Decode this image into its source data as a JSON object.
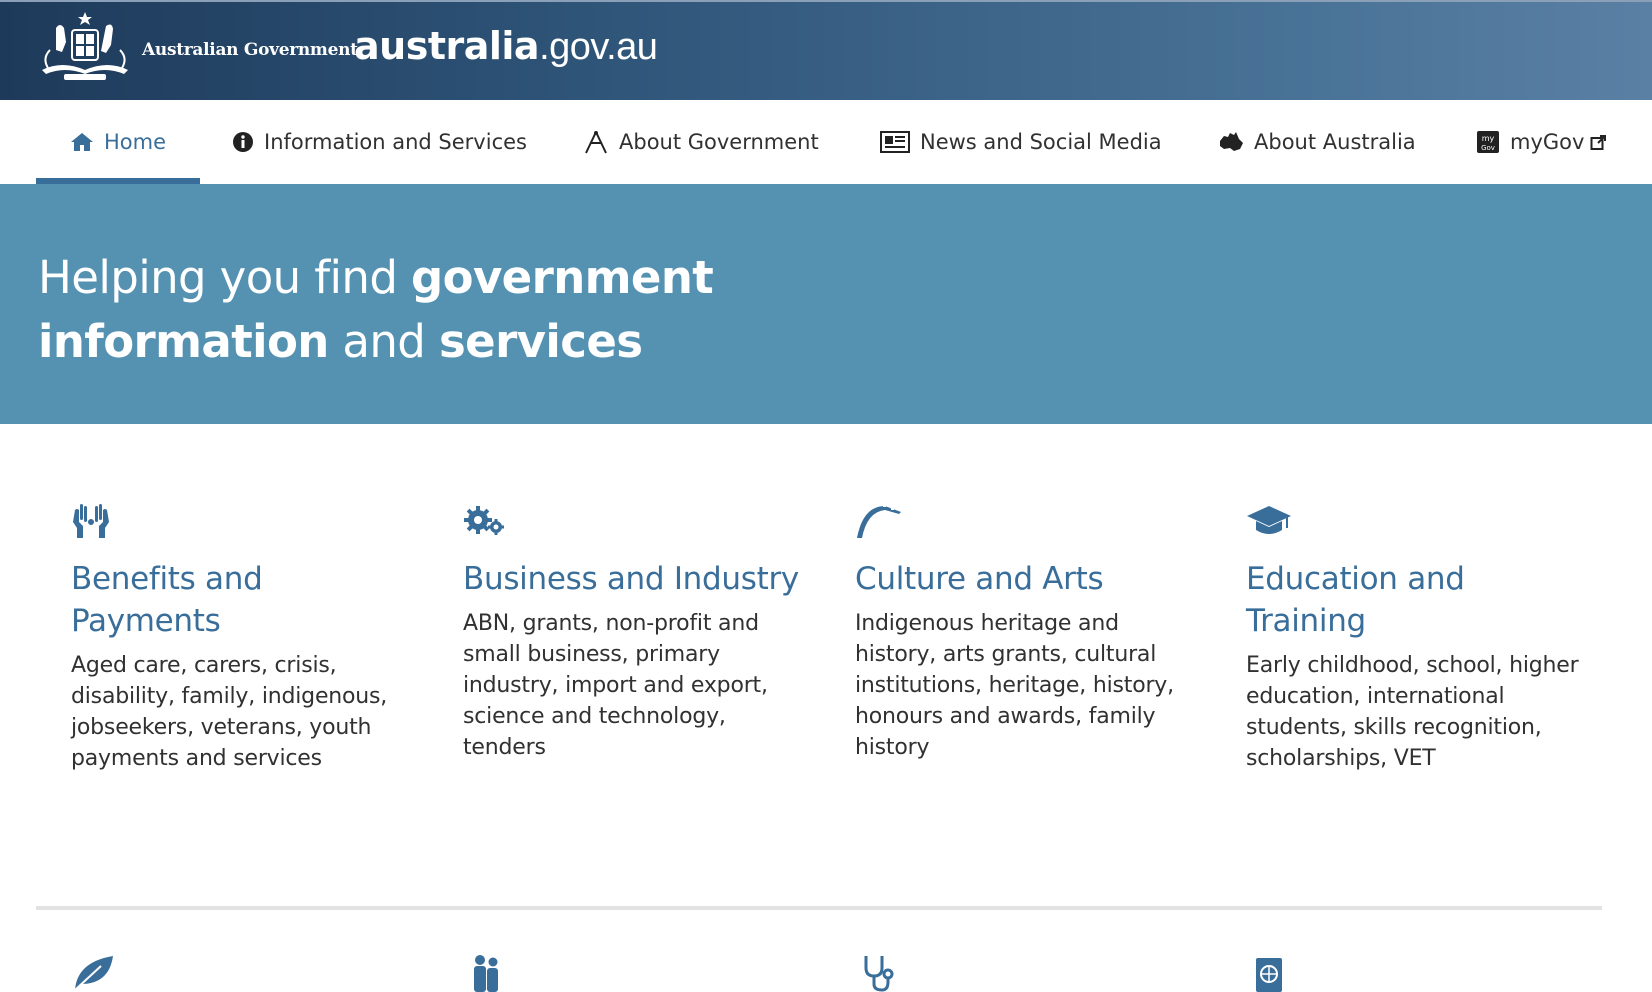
{
  "header": {
    "gov_name": "Australian Government",
    "site_brand": "australia",
    "site_domain": ".gov.au"
  },
  "nav": {
    "items": [
      {
        "label": "Home",
        "icon": "home-icon",
        "active": true
      },
      {
        "label": "Information and Services",
        "icon": "info-icon"
      },
      {
        "label": "About Government",
        "icon": "compass-icon"
      },
      {
        "label": "News and Social Media",
        "icon": "newspaper-icon"
      },
      {
        "label": "About Australia",
        "icon": "australia-map-icon"
      },
      {
        "label": "myGov",
        "icon": "mygov-icon",
        "external": true
      }
    ]
  },
  "hero": {
    "line1_plain": "Helping you find ",
    "line1_bold": "government",
    "line2_bold1": "information",
    "line2_plain": " and ",
    "line2_bold2": "services"
  },
  "categories": [
    {
      "title": "Benefits and Payments",
      "desc": "Aged care, carers, crisis, disability, family, indigenous, jobseekers, veterans, youth payments and services",
      "icon": "hands-icon"
    },
    {
      "title": "Business and Industry",
      "desc": "ABN, grants, non-profit and small business, primary industry, import and export, science and technology, tenders",
      "icon": "gears-icon"
    },
    {
      "title": "Culture and Arts",
      "desc": "Indigenous heritage and history, arts grants, cultural institutions, heritage, history, honours and awards, family history",
      "icon": "boomerang-icon"
    },
    {
      "title": "Education and Training",
      "desc": "Early childhood, school, higher education, international students, skills recognition, scholarships, VET",
      "icon": "graduation-cap-icon"
    }
  ],
  "next_row_icons": [
    "leaf-icon",
    "family-icon",
    "stethoscope-icon",
    "passport-icon"
  ],
  "colors": {
    "banner": "#2e5478",
    "hero": "#5592b2",
    "accent": "#3a6e9a",
    "text": "#313131"
  }
}
